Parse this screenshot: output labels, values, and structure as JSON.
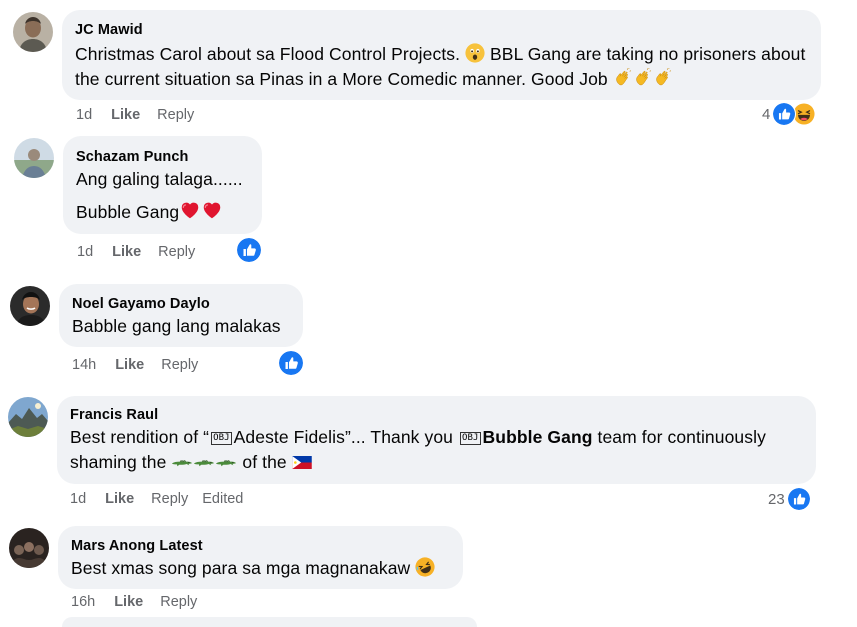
{
  "colors": {
    "bubble_bg": "#f0f2f5",
    "meta_text": "#65676b",
    "like_blue": "#1877f2"
  },
  "comments": [
    {
      "author": "JC Mawid",
      "text_1": "Christmas Carol about sa Flood Control Projects.",
      "text_2": "BBL Gang are taking no prisoners about the current situation sa Pinas in a More Comedic manner. Good Job",
      "time": "1d",
      "like": "Like",
      "reply": "Reply",
      "reaction_count": "4",
      "reaction_icons": [
        "like-icon",
        "laugh-icon"
      ]
    },
    {
      "author": "Schazam Punch",
      "line_1": "Ang galing talaga......",
      "line_2": "Bubble Gang",
      "time": "1d",
      "like": "Like",
      "reply": "Reply",
      "reaction_icons": [
        "like-icon"
      ]
    },
    {
      "author": "Noel Gayamo Daylo",
      "text": "Babble gang lang malakas",
      "time": "14h",
      "like": "Like",
      "reply": "Reply",
      "reaction_icons": [
        "like-icon"
      ]
    },
    {
      "author": "Francis Raul",
      "text_a": "Best rendition of “",
      "glyph": "OBJ",
      "text_b": "Adeste Fidelis”... Thank you",
      "mention": "Bubble Gang",
      "text_c": "team for continuously shaming the",
      "text_d": "of the",
      "time": "1d",
      "like": "Like",
      "reply": "Reply",
      "edited": "Edited",
      "reaction_count": "23",
      "reaction_icons": [
        "like-icon"
      ]
    },
    {
      "author": "Mars Anong Latest",
      "text": "Best xmas song para sa mga magnanakaw",
      "time": "16h",
      "like": "Like",
      "reply": "Reply"
    }
  ]
}
